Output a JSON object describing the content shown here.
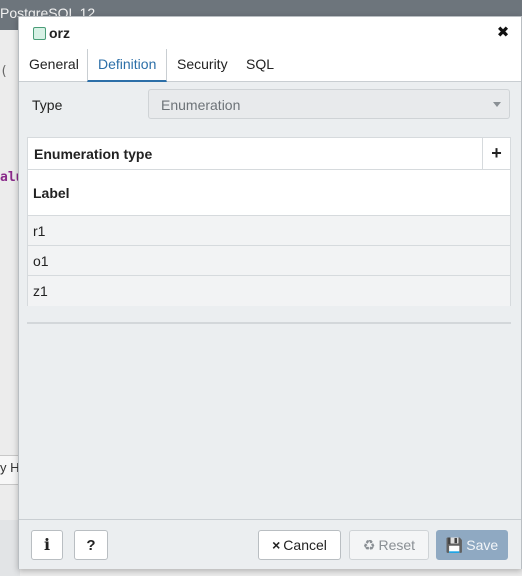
{
  "background": {
    "topbar_title": "PostgreSQL 12",
    "code_line_1": "(",
    "code_line_2": "alu",
    "strip_text": "y H"
  },
  "dialog": {
    "title": "orz",
    "close_icon": "close-icon",
    "tabs": [
      {
        "label": "General",
        "active": false
      },
      {
        "label": "Definition",
        "active": true
      },
      {
        "label": "Security",
        "active": false
      },
      {
        "label": "SQL",
        "active": false
      }
    ],
    "type_field": {
      "label": "Type",
      "value": "Enumeration"
    },
    "enum_grid": {
      "title": "Enumeration type",
      "add_label": "+",
      "column_header": "Label",
      "rows": [
        {
          "label": "r1"
        },
        {
          "label": "o1"
        },
        {
          "label": "z1"
        }
      ]
    },
    "footer": {
      "info_label": "i",
      "help_label": "?",
      "cancel_label": "Cancel",
      "cancel_icon": "×",
      "reset_label": "Reset",
      "reset_icon": "♻",
      "save_label": "Save",
      "save_icon": "💾"
    },
    "colors": {
      "accent": "#2c6fa8",
      "save_button": "#8fa9c2",
      "title_icon": "#4a9d78"
    }
  }
}
